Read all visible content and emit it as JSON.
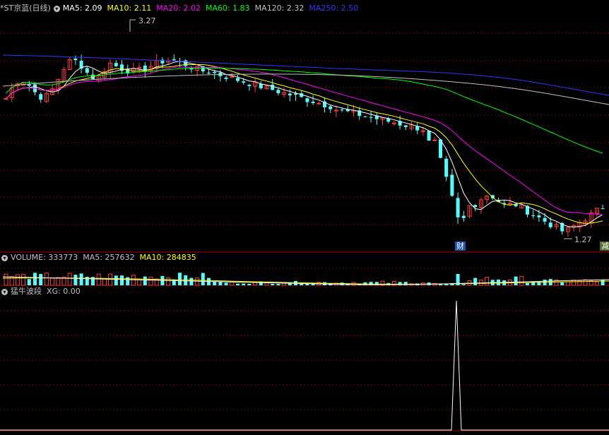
{
  "main": {
    "title": "*ST京蓝(日线)",
    "ma": [
      {
        "label": "MA5: 2.09",
        "color": "#ffffff"
      },
      {
        "label": "MA10: 2.11",
        "color": "#ffff00"
      },
      {
        "label": "MA20: 2.02",
        "color": "#ff00ff"
      },
      {
        "label": "MA60: 1.83",
        "color": "#00ff00"
      },
      {
        "label": "MA120: 2.32",
        "color": "#c0c0c0"
      },
      {
        "label": "MA250: 2.50",
        "color": "#3333ff"
      }
    ],
    "high_marker": "3.27",
    "low_marker": "1.27",
    "badge_cai": "财",
    "badge_jian": "减"
  },
  "volume": {
    "label": "VOLUME: 333773",
    "ma5": "MA5: 257632",
    "ma10": "MA10: 284835"
  },
  "indicator": {
    "label": "猛牛波段",
    "xg": "XG: 0.00"
  },
  "colors": {
    "up": "#ff3c3c",
    "down": "#54ffff",
    "grid": "#7a0000",
    "ma5": "#ffffff",
    "ma10": "#ffff00",
    "ma20": "#ff00ff",
    "ma60": "#00ff00",
    "ma120": "#c0c0c0",
    "ma250": "#3333ff"
  },
  "chart_data": {
    "type": "candlestick",
    "xg_signal_index": 53
  }
}
